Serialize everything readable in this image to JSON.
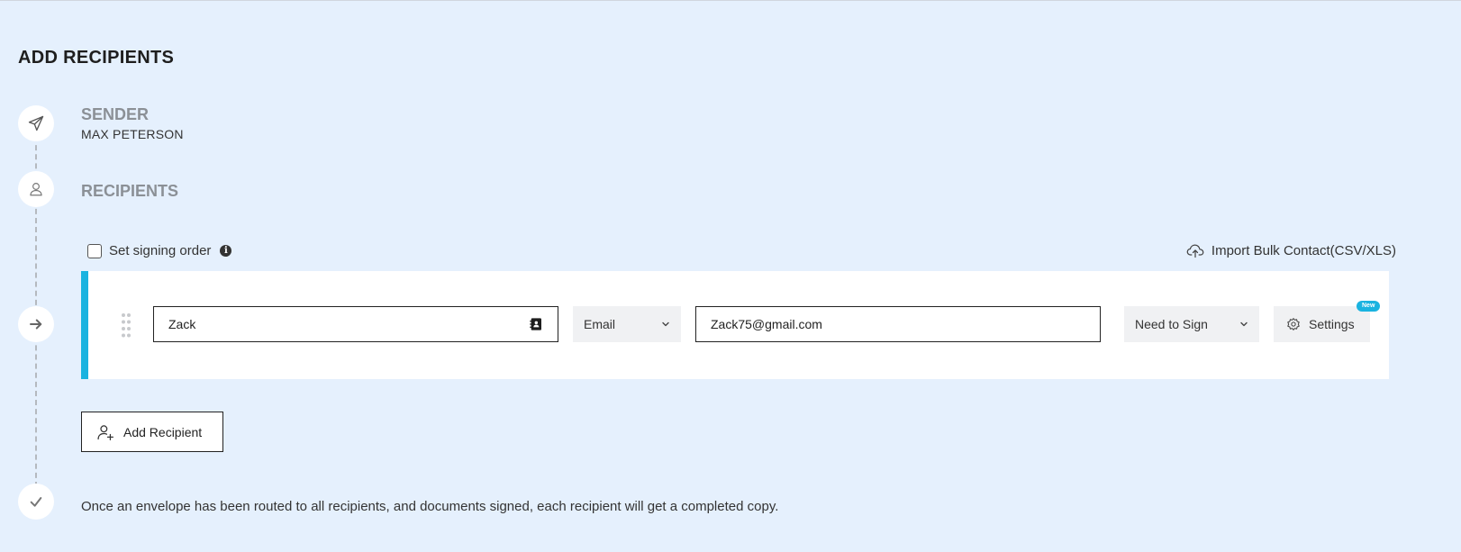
{
  "page": {
    "title": "ADD RECIPIENTS"
  },
  "timeline": {
    "steps": [
      {
        "icon": "paper-plane-icon"
      },
      {
        "icon": "user-icon"
      },
      {
        "icon": "arrow-right-icon"
      },
      {
        "icon": "check-icon"
      }
    ]
  },
  "sender": {
    "label": "SENDER",
    "name": "MAX PETERSON"
  },
  "recipients": {
    "label": "RECIPIENTS",
    "signing_order_label": "Set signing order",
    "signing_order_checked": false,
    "import_bulk_label": "Import Bulk Contact(CSV/XLS)",
    "list": [
      {
        "name": "Zack",
        "delivery_method": "Email",
        "email": "Zack75@gmail.com",
        "role": "Need to Sign",
        "settings_label": "Settings",
        "badge": "New"
      }
    ],
    "add_button_label": "Add Recipient"
  },
  "footer": {
    "note": "Once an envelope has been routed to all recipients, and documents signed, each recipient will get a completed copy."
  },
  "colors": {
    "background": "#e5f0fd",
    "accent": "#1ab3e0",
    "muted_heading": "#8b9096"
  }
}
